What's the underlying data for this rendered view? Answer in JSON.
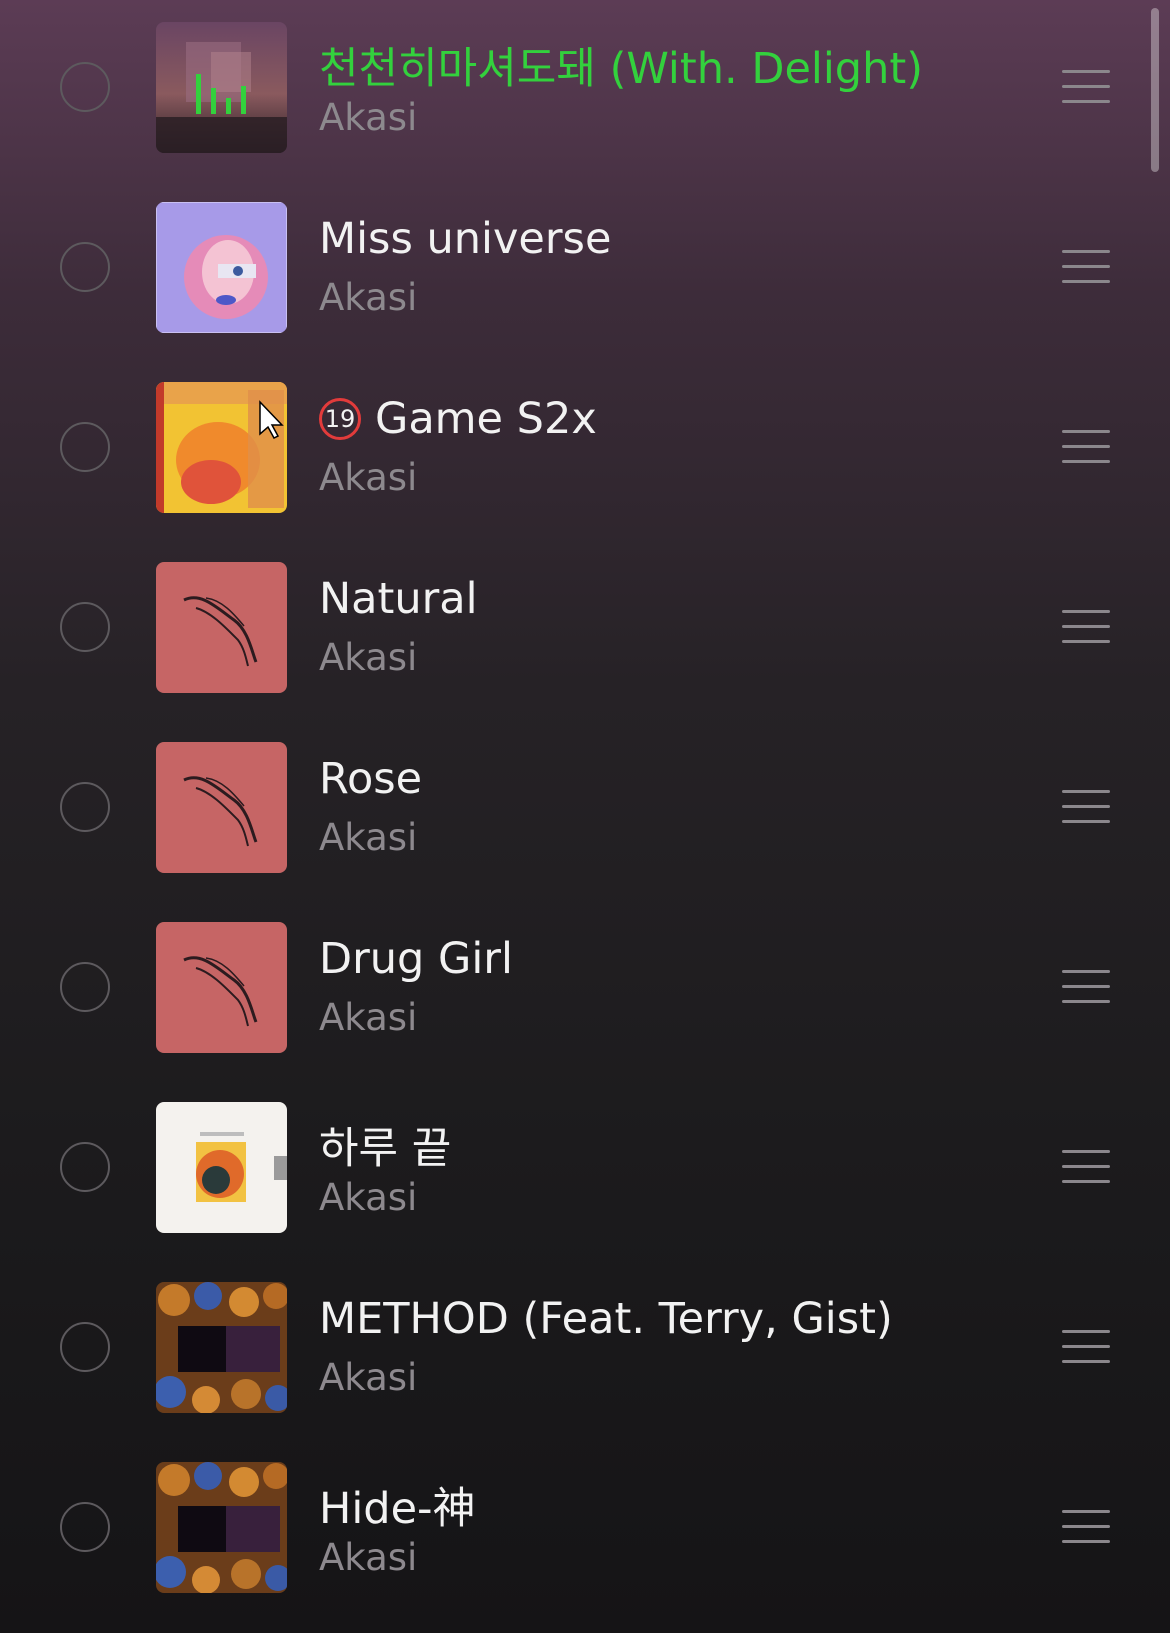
{
  "colors": {
    "playing_accent": "#33d13d",
    "age_badge_ring": "#e23b3b",
    "artist_text": "#8d898e"
  },
  "tracks": [
    {
      "title": "천천히마셔도돼 (With. Delight)",
      "artist": "Akasi",
      "playing": true,
      "art": "pink-dusk-cover-with-eq-icon"
    },
    {
      "title": "Miss universe",
      "artist": "Akasi",
      "art": "miss-universe-cover"
    },
    {
      "title": "Game S2x",
      "artist": "Akasi",
      "age_rating": "19",
      "art": "game-s2x-cover"
    },
    {
      "title": "Natural",
      "artist": "Akasi",
      "art": "pink-sketch-cover"
    },
    {
      "title": "Rose",
      "artist": "Akasi",
      "art": "pink-sketch-cover"
    },
    {
      "title": "Drug Girl",
      "artist": "Akasi",
      "art": "pink-sketch-cover"
    },
    {
      "title": "하루 끝",
      "artist": "Akasi",
      "art": "end-of-the-day-cover"
    },
    {
      "title": "METHOD (Feat. Terry, Gist)",
      "artist": "Akasi",
      "art": "coins-dark-cover"
    },
    {
      "title": "Hide-神",
      "artist": "Akasi",
      "art": "coins-dark-cover"
    }
  ]
}
